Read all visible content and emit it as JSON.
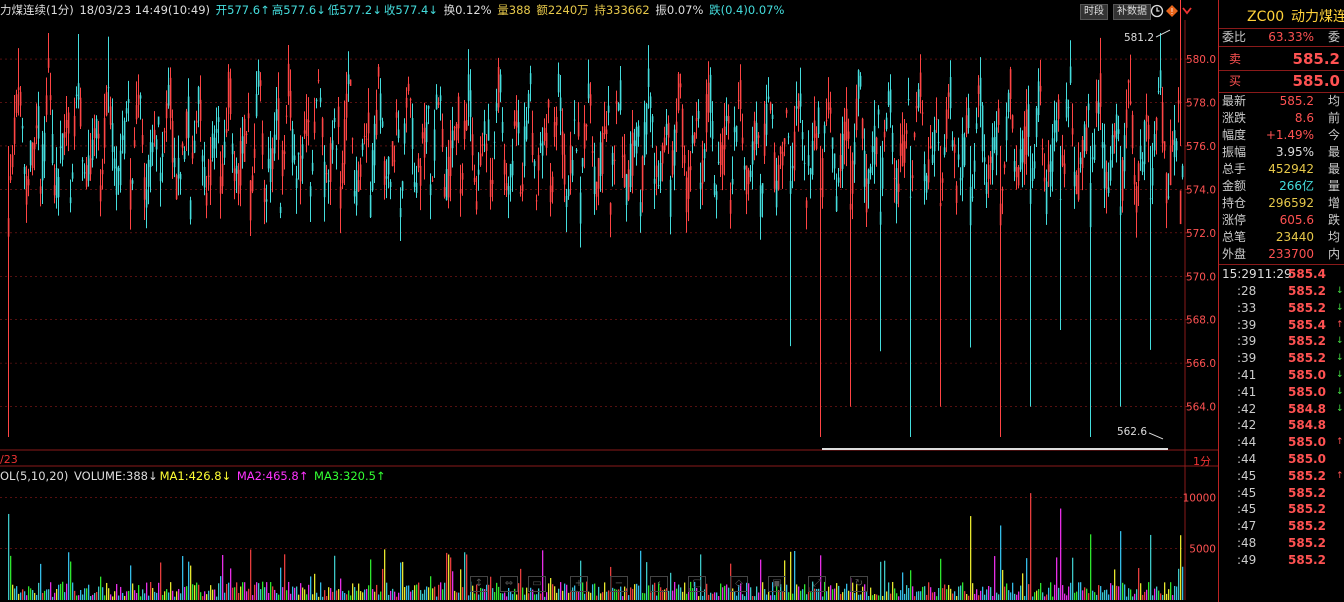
{
  "header": {
    "title": "力煤连续(1分)",
    "datetime": "18/03/23 14:49(10:49)",
    "open": "开577.6↑",
    "high": "高577.6↓",
    "low": "低577.2↓",
    "close": "收577.4↓",
    "turnover": "换0.12%",
    "volume": "量388",
    "amount": "额2240万",
    "position": "持333662",
    "amplitude": "振0.07%",
    "change": "跌(0.4)0.07%",
    "btn_timeshare": "时段",
    "btn_supplement": "补数据",
    "icons": [
      "clock-icon",
      "warning-icon",
      "arrow-icon"
    ]
  },
  "chart_data": {
    "type": "candlestick",
    "period": "1分",
    "ylim": [
      562,
      581.8
    ],
    "yticks": [
      564.0,
      566.0,
      568.0,
      570.0,
      572.0,
      574.0,
      576.0,
      578.0,
      580.0
    ],
    "annotations": [
      {
        "label": "581.2",
        "kind": "high"
      },
      {
        "label": "562.6",
        "kind": "low"
      }
    ],
    "x_axis_partial": "/23",
    "volume": {
      "label": "OL(5,10,20)",
      "volume": "VOLUME:388↓",
      "ma1": "MA1:426.8↓",
      "ma2": "MA2:465.8↑",
      "ma3": "MA3:320.5↑",
      "yticks": [
        5000,
        10000
      ],
      "ylim": [
        0,
        11500
      ]
    },
    "colors": {
      "up": "#ff4444",
      "down": "#44dddd",
      "grid": "#8a1a1a",
      "ma1": "#ffff33",
      "ma2": "#ff33ff",
      "ma3": "#33ff33"
    }
  },
  "sidebar": {
    "symbol": "ZC00",
    "name": "动力煤连",
    "ratio_label": "委比",
    "ratio_value": "63.33%",
    "ratio_cut": "委",
    "sell_label": "卖",
    "sell_value": "585.2",
    "buy_label": "买",
    "buy_value": "585.0",
    "stats": [
      {
        "label": "最新",
        "value": "585.2",
        "color": "red",
        "cut": "均"
      },
      {
        "label": "涨跌",
        "value": "8.6",
        "color": "red",
        "cut": "前"
      },
      {
        "label": "幅度",
        "value": "+1.49%",
        "color": "red",
        "cut": "今"
      },
      {
        "label": "振幅",
        "value": "3.95%",
        "color": "white",
        "cut": "最"
      },
      {
        "label": "总手",
        "value": "452942",
        "color": "yellow",
        "cut": "最"
      },
      {
        "label": "金额",
        "value": "266亿",
        "color": "cyan",
        "cut": "量"
      },
      {
        "label": "持仓",
        "value": "296592",
        "color": "yellow",
        "cut": "增"
      },
      {
        "label": "涨停",
        "value": "605.6",
        "color": "red",
        "cut": "跌"
      },
      {
        "label": "总笔",
        "value": "23440",
        "color": "yellow",
        "cut": "均"
      },
      {
        "label": "外盘",
        "value": "233700",
        "color": "red",
        "cut": "内"
      }
    ],
    "tick_header": {
      "time1": "15:29",
      "time2": "11:29",
      "price": "585.4"
    },
    "ticks": [
      {
        "time": ":28",
        "price": "585.2",
        "arrow": "↓"
      },
      {
        "time": ":33",
        "price": "585.2",
        "arrow": "↓"
      },
      {
        "time": ":39",
        "price": "585.4",
        "arrow": "↑"
      },
      {
        "time": ":39",
        "price": "585.2",
        "arrow": "↓"
      },
      {
        "time": ":39",
        "price": "585.2",
        "arrow": "↓"
      },
      {
        "time": ":41",
        "price": "585.0",
        "arrow": "↓"
      },
      {
        "time": ":41",
        "price": "585.0",
        "arrow": "↓"
      },
      {
        "time": ":42",
        "price": "584.8",
        "arrow": "↓"
      },
      {
        "time": ":42",
        "price": "584.8",
        "arrow": ""
      },
      {
        "time": ":44",
        "price": "585.0",
        "arrow": "↑"
      },
      {
        "time": ":44",
        "price": "585.0",
        "arrow": ""
      },
      {
        "time": ":45",
        "price": "585.2",
        "arrow": "↑"
      },
      {
        "time": ":45",
        "price": "585.2",
        "arrow": ""
      },
      {
        "time": ":45",
        "price": "585.2",
        "arrow": ""
      },
      {
        "time": ":47",
        "price": "585.2",
        "arrow": ""
      },
      {
        "time": ":48",
        "price": "585.2",
        "arrow": ""
      },
      {
        "time": ":49",
        "price": "585.2",
        "arrow": ""
      }
    ]
  }
}
